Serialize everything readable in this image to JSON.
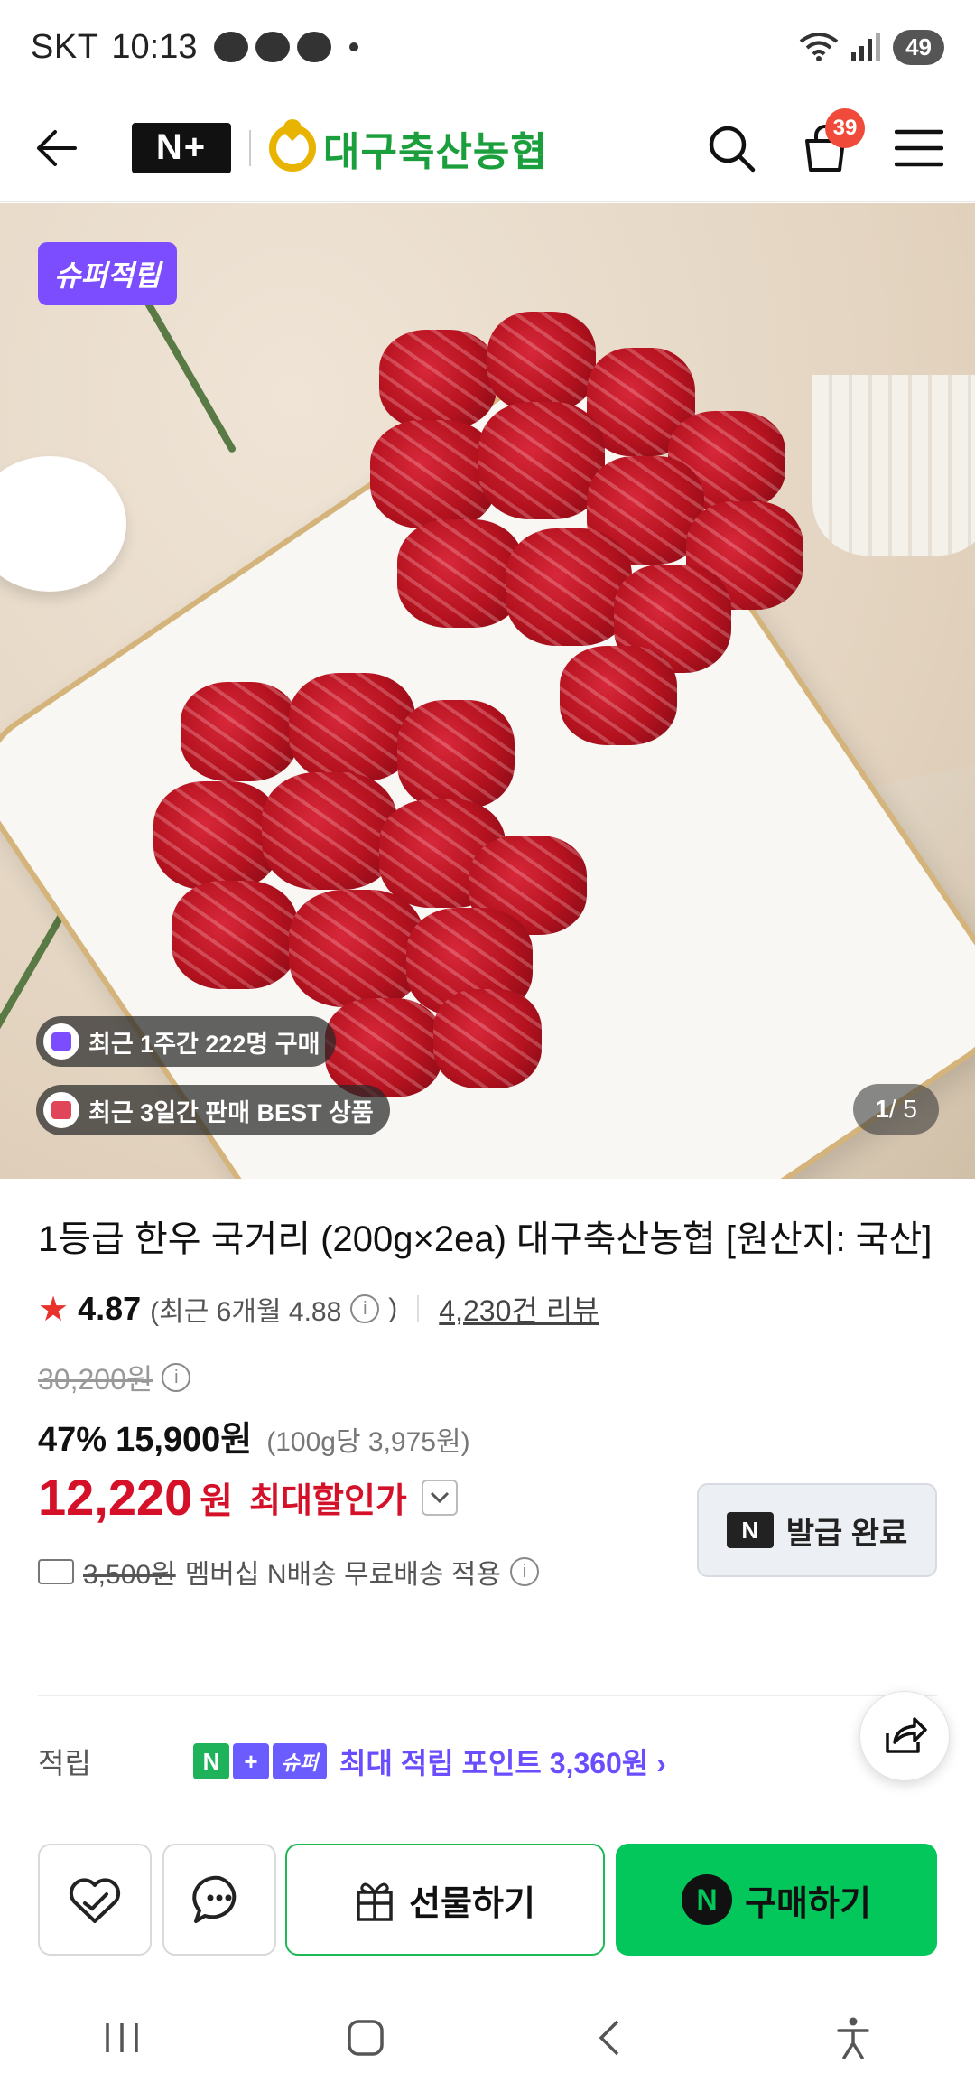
{
  "status_bar": {
    "carrier": "SKT",
    "time": "10:13",
    "battery": "49"
  },
  "header": {
    "brand_badge": "N+",
    "store_name": "대구축산농협",
    "cart_count": "39"
  },
  "hero": {
    "super_tag": "슈퍼적립",
    "pill_purchase": "최근 1주간 222명 구매",
    "pill_best": "최근 3일간 판매 BEST 상품",
    "pager_current": "1",
    "pager_total": " / 5"
  },
  "product": {
    "title": "1등급 한우 국거리 (200g×2ea) 대구축산농협 [원산지: 국산]",
    "rating": "4.87",
    "rating_recent": "(최근 6개월 4.88",
    "rating_recent_close": ")",
    "reviews": "4,230건 리뷰",
    "original_price": "30,200원",
    "discount_pct": "47%",
    "discount_price": "15,900원",
    "unit_price": "(100g당 3,975원)",
    "final_price": "12,220",
    "final_won": "원",
    "final_label": "최대할인가",
    "coupon_badge": "N",
    "coupon_label": "발급 완료",
    "delivery_fee": "3,500원",
    "delivery_text": "멤버십 N배송 무료배송 적용"
  },
  "reward": {
    "label": "적립",
    "badge_n": "N",
    "badge_plus": "+",
    "badge_super": "슈퍼",
    "text": "최대 적립 포인트 3,360원 ›"
  },
  "actions": {
    "gift_label": "선물하기",
    "buy_badge": "N",
    "buy_label": "구매하기"
  },
  "colors": {
    "accent_green": "#03c75a",
    "price_red": "#d5112a",
    "reward_purple": "#6b4dff",
    "badge_red": "#f04a3a"
  }
}
